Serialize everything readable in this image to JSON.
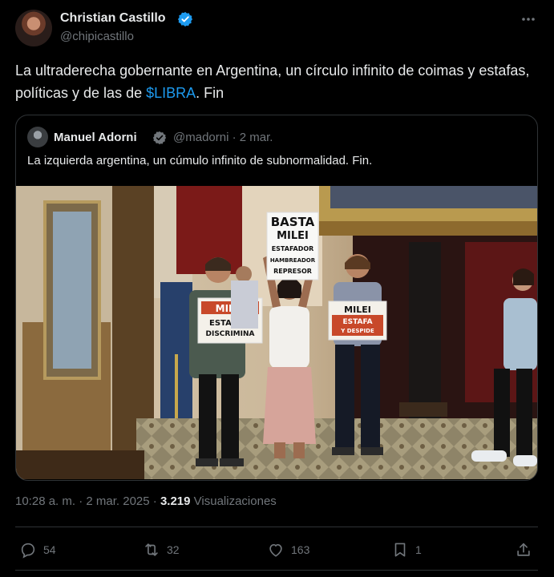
{
  "author": {
    "name": "Christian Castillo",
    "handle": "@chipicastillo"
  },
  "tweet": {
    "text_before": "La ultraderecha gobernante en Argentina, un círculo infinito de coimas y estafas, políticas y de las de ",
    "cashtag": "$LIBRA",
    "text_after": ". Fin"
  },
  "quoted": {
    "name": "Manuel Adorni",
    "handle": "@madorni",
    "separator": "·",
    "date": "2 mar.",
    "text": "La izquierda argentina, un cúmulo infinito de subnormalidad. Fin.",
    "image": {
      "signs": {
        "left": [
          "MILEI",
          "ESTAFA Y",
          "DISCRIMINA"
        ],
        "center": [
          "BASTA",
          "MILEI",
          "ESTAFADOR",
          "HAMBREADOR",
          "REPRESOR"
        ],
        "right": [
          "MILEI",
          "ESTAFA",
          "Y DESPIDE"
        ]
      }
    }
  },
  "meta": {
    "time": "10:28 a. m.",
    "separator": "·",
    "date": "2 mar. 2025",
    "views_count": "3.219",
    "views_label": "Visualizaciones"
  },
  "actions": {
    "replies": "54",
    "reposts": "32",
    "likes": "163",
    "bookmarks": "1"
  },
  "colors": {
    "background": "#000000",
    "text": "#e7e9ea",
    "secondary": "#71767b",
    "accent": "#1d9bf0",
    "border": "#2f3336"
  },
  "icons": [
    "verified-badge-icon",
    "more-icon",
    "reply-icon",
    "repost-icon",
    "like-icon",
    "bookmark-icon",
    "share-icon"
  ]
}
